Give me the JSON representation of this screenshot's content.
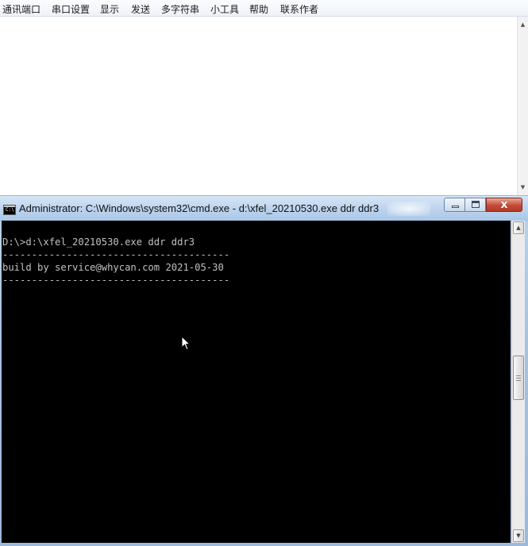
{
  "menu": {
    "items": [
      "通讯端口",
      "串口设置",
      "显示",
      "发送",
      "多字符串",
      "小工具",
      "帮助",
      "联系作者"
    ]
  },
  "cmd": {
    "title": "Administrator: C:\\Windows\\system32\\cmd.exe - d:\\xfel_20210530.exe  ddr ddr3",
    "icon_label": "C:\\",
    "lines": [
      "D:\\>d:\\xfel_20210530.exe ddr ddr3",
      "---------------------------------------",
      "build by service@whycan.com 2021-05-30",
      "---------------------------------------"
    ],
    "close_label": "x"
  },
  "icons": {
    "cmd": "cmd-icon",
    "minimize": "minimize-icon",
    "maximize": "maximize-icon",
    "close": "close-icon",
    "cursor": "mouse-cursor-icon"
  },
  "colors": {
    "console_bg": "#000000",
    "console_text": "#c0c0c0",
    "close_button": "#c64a35",
    "titlebar": "#bfd5ee"
  }
}
